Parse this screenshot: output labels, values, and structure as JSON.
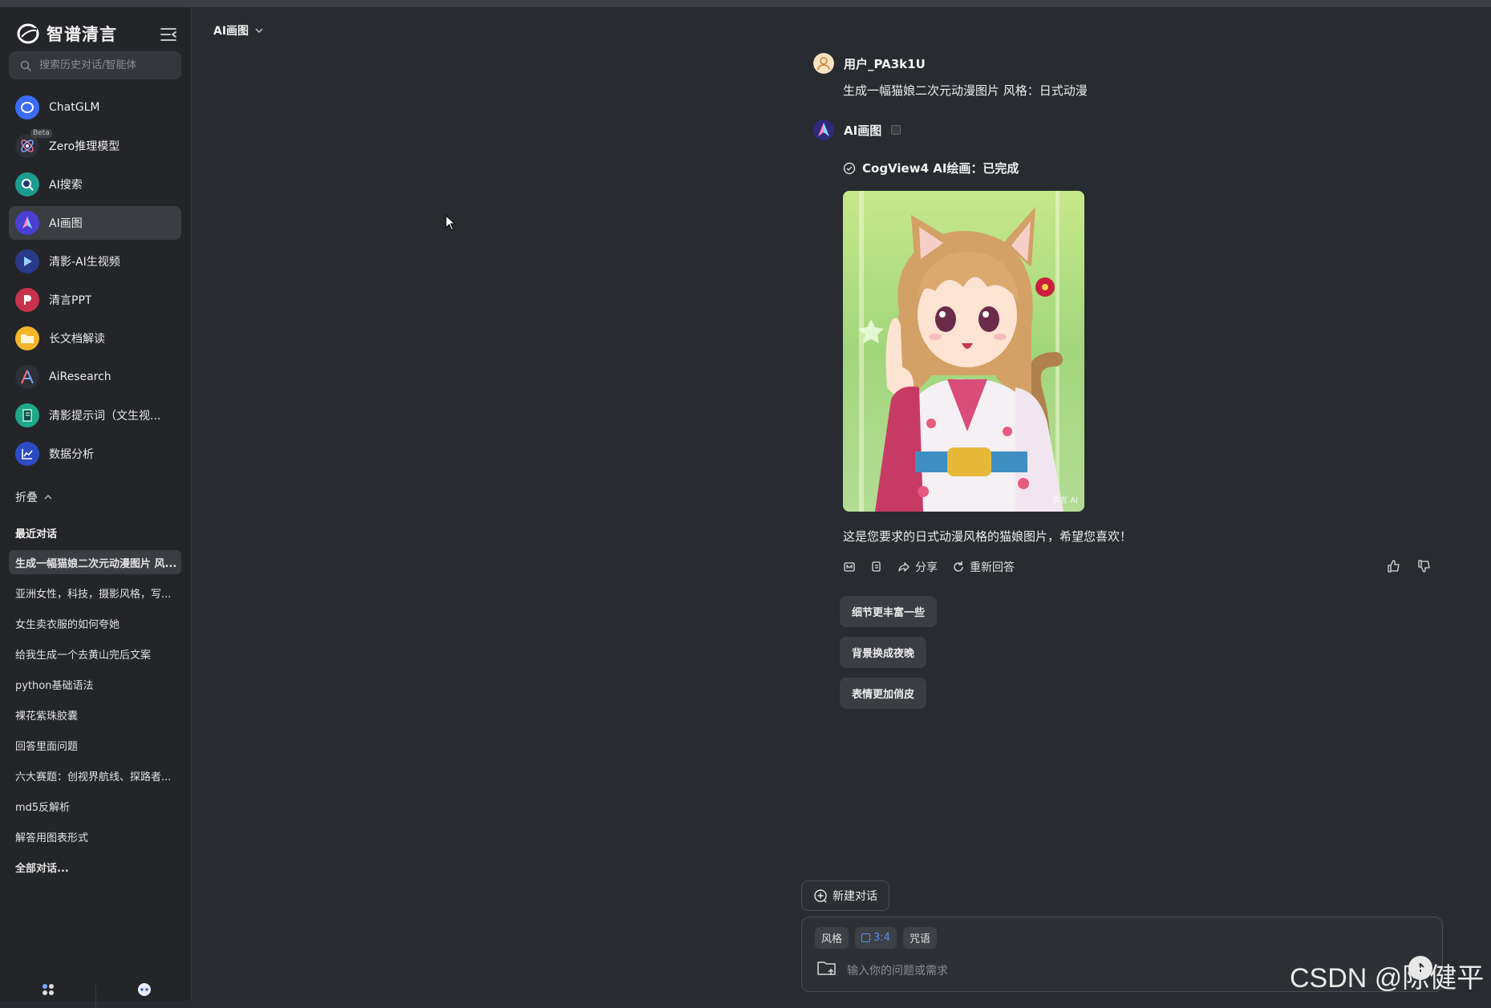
{
  "app": {
    "logo_text": "智谱清言"
  },
  "search": {
    "placeholder": "搜索历史对话/智能体"
  },
  "agents": [
    {
      "label": "ChatGLM",
      "icon": "chatglm-icon",
      "color": "#3b6cf6"
    },
    {
      "label": "Zero推理模型",
      "icon": "atom-icon",
      "color": "#2d3036",
      "badge": "Beta"
    },
    {
      "label": "AI搜索",
      "icon": "ai-search-icon",
      "color": "#1c9a8f"
    },
    {
      "label": "AI画图",
      "icon": "ai-draw-icon",
      "color": "#4a3fd1"
    },
    {
      "label": "清影-AI生视频",
      "icon": "video-play-icon",
      "color": "#2a3a8a"
    },
    {
      "label": "清言PPT",
      "icon": "ppt-icon",
      "color": "#c8324a"
    },
    {
      "label": "长文档解读",
      "icon": "folder-icon",
      "color": "#f3b52a"
    },
    {
      "label": "AiResearch",
      "icon": "research-a-icon",
      "color": "#2d3036"
    },
    {
      "label": "清影提示词（文生视...",
      "icon": "prompt-book-icon",
      "color": "#1fa789"
    },
    {
      "label": "数据分析",
      "icon": "chart-icon",
      "color": "#2c4cc4"
    }
  ],
  "fold_label": "折叠",
  "recent_title": "最近对话",
  "history": [
    "生成一幅猫娘二次元动漫图片 风...",
    "亚洲女性，科技，摄影风格，写...",
    "女生卖衣服的如何夸她",
    "给我生成一个去黄山完后文案",
    "python基础语法",
    "裸花紫珠胶囊",
    "回答里面问题",
    "六大赛题：创视界航线、探路者...",
    "md5反解析",
    "解答用图表形式"
  ],
  "all_conversations": "全部对话...",
  "header": {
    "title": "AI画图"
  },
  "user_message": {
    "name": "用户_PA3k1U",
    "text": "生成一幅猫娘二次元动漫图片 风格：日式动漫"
  },
  "ai_message": {
    "name": "AI画图",
    "status": "CogView4 AI绘画：已完成",
    "image_watermark": "清言 AI",
    "reply": "这是您要求的日式动漫风格的猫娘图片，希望您喜欢！",
    "actions": {
      "share": "分享",
      "regenerate": "重新回答"
    }
  },
  "suggestions": [
    "细节更丰富一些",
    "背景换成夜晚",
    "表情更加俏皮"
  ],
  "composer": {
    "new_chat": "新建对话",
    "tags": {
      "style": "风格",
      "ratio": "3:4",
      "spell": "咒语"
    },
    "placeholder": "输入你的问题或需求"
  },
  "watermark": "CSDN @陈健平"
}
